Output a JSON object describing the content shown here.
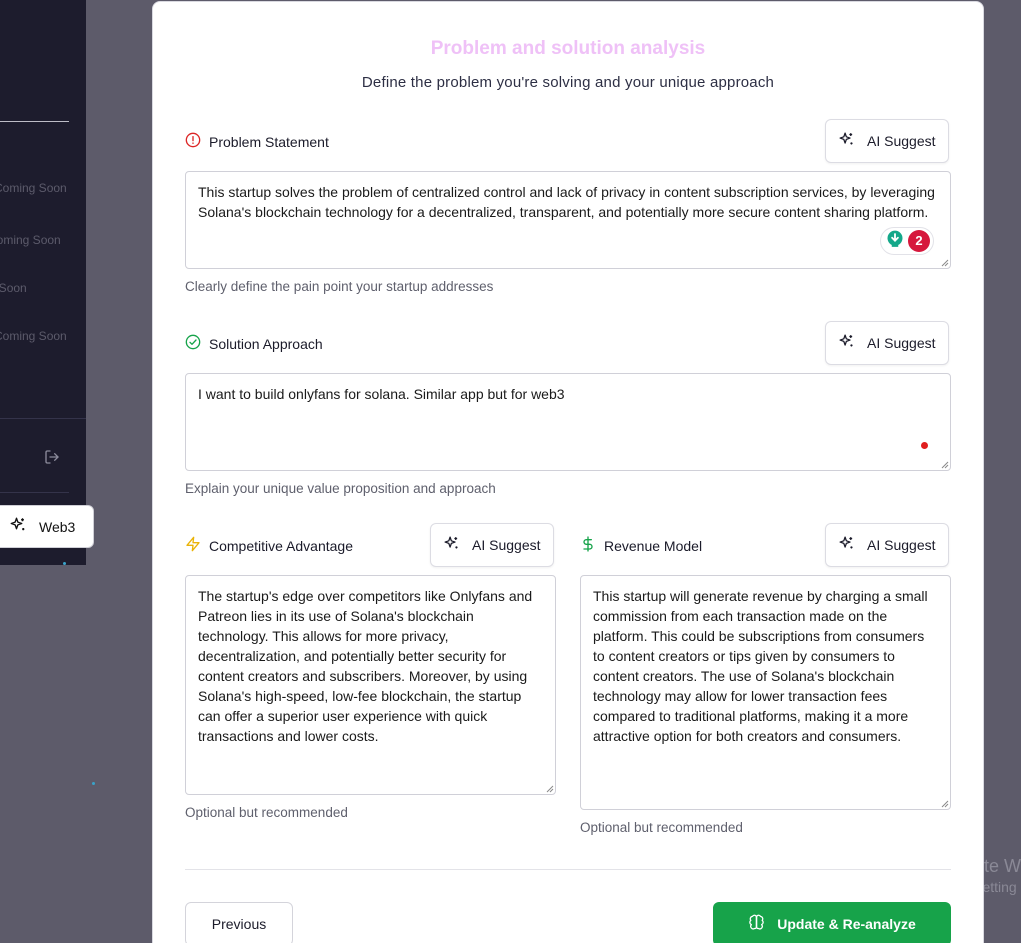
{
  "sidebar": {
    "coming_soon": [
      "Coming Soon",
      "Coming Soon",
      "Coming Soon",
      "Coming Soon"
    ],
    "active_item": "Web3"
  },
  "modal": {
    "title": "Problem and solution analysis",
    "subtitle": "Define the problem you're solving and your unique approach"
  },
  "fields": {
    "problem": {
      "label": "Problem Statement",
      "ai_label": "AI Suggest",
      "value": "This startup solves the problem of centralized control and lack of privacy in content subscription services, by leveraging Solana's blockchain technology for a decentralized, transparent, and potentially more secure content sharing platform.",
      "hint": "Clearly define the pain point your startup addresses",
      "badge_count": "2"
    },
    "solution": {
      "label": "Solution Approach",
      "ai_label": "AI Suggest",
      "value": "I want to build onlyfans for solana. Similar app but for web3",
      "hint": "Explain your unique value proposition and approach"
    },
    "advantage": {
      "label": "Competitive Advantage",
      "ai_label": "AI Suggest",
      "value": "The startup's edge over competitors like Onlyfans and Patreon lies in its use of Solana's blockchain technology. This allows for more privacy, decentralization, and potentially better security for content creators and subscribers. Moreover, by using Solana's high-speed, low-fee blockchain, the startup can offer a superior user experience with quick transactions and lower costs.",
      "hint": "Optional but recommended"
    },
    "revenue": {
      "label": "Revenue Model",
      "ai_label": "AI Suggest",
      "value": "This startup will generate revenue by charging a small commission from each transaction made on the platform. This could be subscriptions from consumers to content creators or tips given by consumers to content creators. The use of Solana's blockchain technology may allow for lower transaction fees compared to traditional platforms, making it a more attractive option for both creators and consumers.",
      "hint": "Optional but recommended"
    }
  },
  "footer": {
    "previous_label": "Previous",
    "update_label": "Update & Re-analyze"
  },
  "watermark": {
    "line1": "Activate W",
    "line2": "Go to Setting"
  },
  "colors": {
    "title": "#efc1f7",
    "problem_icon": "#dc2626",
    "solution_icon": "#16a34a",
    "advantage_icon": "#eab308",
    "revenue_icon": "#16a34a",
    "primary_button": "#17a34a",
    "badge": "#d6173c"
  }
}
